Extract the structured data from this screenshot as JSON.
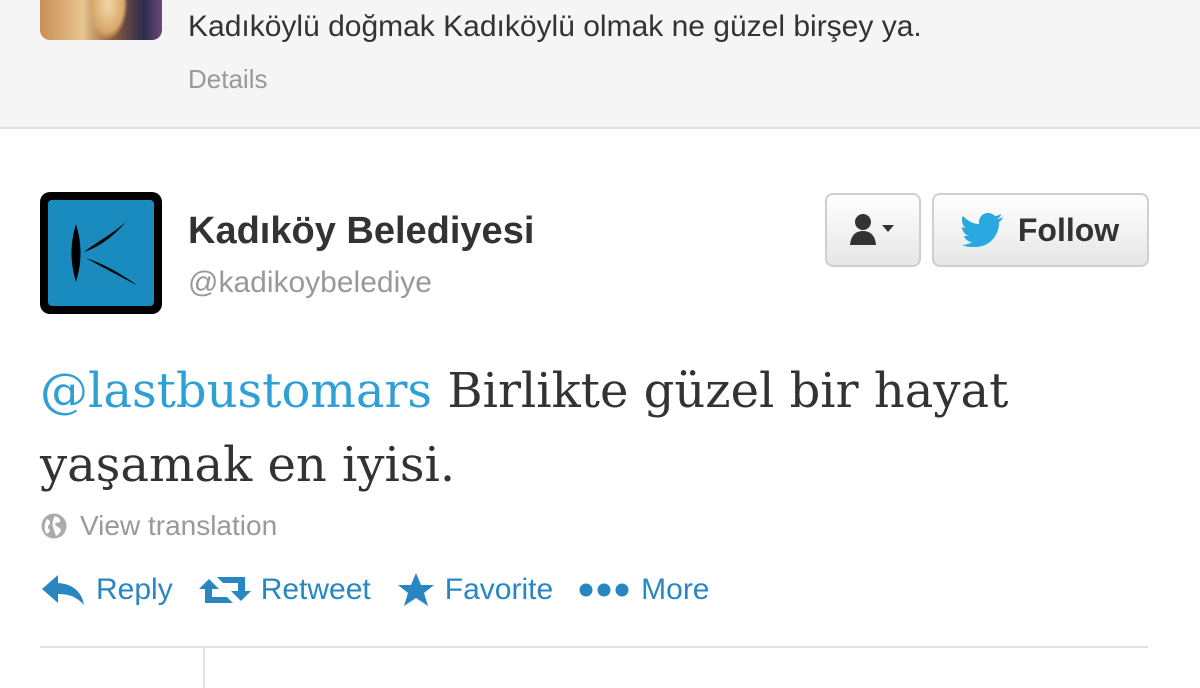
{
  "previous_tweet": {
    "text": "Kadıköylü doğmak Kadıköylü olmak ne güzel birşey ya.",
    "details_label": "Details"
  },
  "tweet": {
    "user_name": "Kadıköy Belediyesi",
    "user_handle": "@kadikoybelediye",
    "mention": "@lastbustomars",
    "text_line1_rest": " Birlikte güzel bir hayat",
    "text_line2": "yaşamak en iyisi.",
    "translation_label": "View translation",
    "follow_label": "Follow"
  },
  "actions": {
    "reply": "Reply",
    "retweet": "Retweet",
    "favorite": "Favorite",
    "more": "More"
  },
  "colors": {
    "link": "#2a86c1",
    "mention": "#2fa0d6",
    "twitter_blue": "#2aa9e0",
    "avatar_blue": "#1a8bbf"
  }
}
